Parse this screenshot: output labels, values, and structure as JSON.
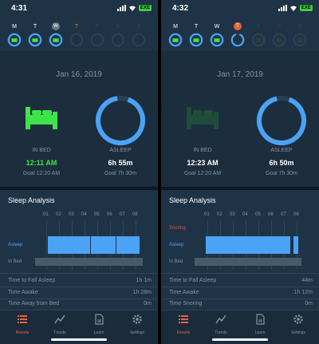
{
  "colors": {
    "accent": "#4aa3f5",
    "bed_green": "#3ee54a",
    "bed_dim": "#1f4d3a",
    "today_orange": "#e8633a",
    "snoring_red": "#e0524d",
    "text_gray": "#8594a3"
  },
  "screens": [
    {
      "status": {
        "time": "4:31",
        "battery": "EXE"
      },
      "week": [
        {
          "letter": "M",
          "state": "past",
          "ring": 0.85
        },
        {
          "letter": "T",
          "state": "past",
          "ring": 0.85
        },
        {
          "letter": "W",
          "state": "selected",
          "ring": 0.85
        },
        {
          "letter": "T",
          "state": "today",
          "ring": 0
        },
        {
          "letter": "F",
          "state": "future",
          "ring": 0
        },
        {
          "letter": "S",
          "state": "future",
          "ring": 0
        },
        {
          "letter": "S",
          "state": "future",
          "ring": 0
        }
      ],
      "date": "Jan 16, 2019",
      "in_bed": {
        "label": "IN BED",
        "value": "12:11 AM",
        "goal": "Goal 12:20 AM",
        "on_time": true
      },
      "asleep": {
        "label": "ASLEEP",
        "value": "6h 55m",
        "goal": "Goal 7h 30m",
        "progress": 0.92
      },
      "analysis": {
        "title": "Sleep Analysis",
        "hours": [
          "01",
          "02",
          "03",
          "04",
          "05",
          "06",
          "07",
          "08"
        ],
        "rows": [
          {
            "label": "Asleep",
            "color": "#4aa3f5"
          },
          {
            "label": "In Bed",
            "color": "#8594a3"
          }
        ]
      },
      "stats": [
        {
          "label": "Time to Fall Asleep",
          "value": "1h 1m"
        },
        {
          "label": "Time Awake",
          "value": "1h 28m"
        },
        {
          "label": "Time Away from Bed",
          "value": "0m"
        }
      ],
      "tabs": [
        "Results",
        "Trends",
        "Learn",
        "Settings"
      ]
    },
    {
      "status": {
        "time": "4:32",
        "battery": "EXE"
      },
      "week": [
        {
          "letter": "M",
          "state": "past",
          "ring": 0.85
        },
        {
          "letter": "T",
          "state": "past",
          "ring": 0.85
        },
        {
          "letter": "W",
          "state": "past",
          "ring": 0.85
        },
        {
          "letter": "T",
          "state": "today-selected",
          "ring": 0.9
        },
        {
          "letter": "F",
          "state": "future",
          "ring": 0
        },
        {
          "letter": "S",
          "state": "future",
          "ring": 0
        },
        {
          "letter": "S",
          "state": "future",
          "ring": 0
        }
      ],
      "date": "Jan 17, 2019",
      "in_bed": {
        "label": "IN BED",
        "value": "12:23 AM",
        "goal": "Goal 12:20 AM",
        "on_time": false
      },
      "asleep": {
        "label": "ASLEEP",
        "value": "6h 50m",
        "goal": "Goal 7h 30m",
        "progress": 0.91
      },
      "analysis": {
        "title": "Sleep Analysis",
        "hours": [
          "01",
          "02",
          "03",
          "04",
          "05",
          "06",
          "07",
          "08"
        ],
        "rows": [
          {
            "label": "Snoring",
            "color": "#e0524d"
          },
          {
            "label": "Asleep",
            "color": "#4aa3f5"
          },
          {
            "label": "In Bed",
            "color": "#8594a3"
          }
        ]
      },
      "stats": [
        {
          "label": "Time to Fall Asleep",
          "value": "44m"
        },
        {
          "label": "Time Awake",
          "value": "1h 12m"
        },
        {
          "label": "Time Snoring",
          "value": "0m"
        }
      ],
      "tabs": [
        "Results",
        "Trends",
        "Learn",
        "Settings"
      ]
    }
  ]
}
